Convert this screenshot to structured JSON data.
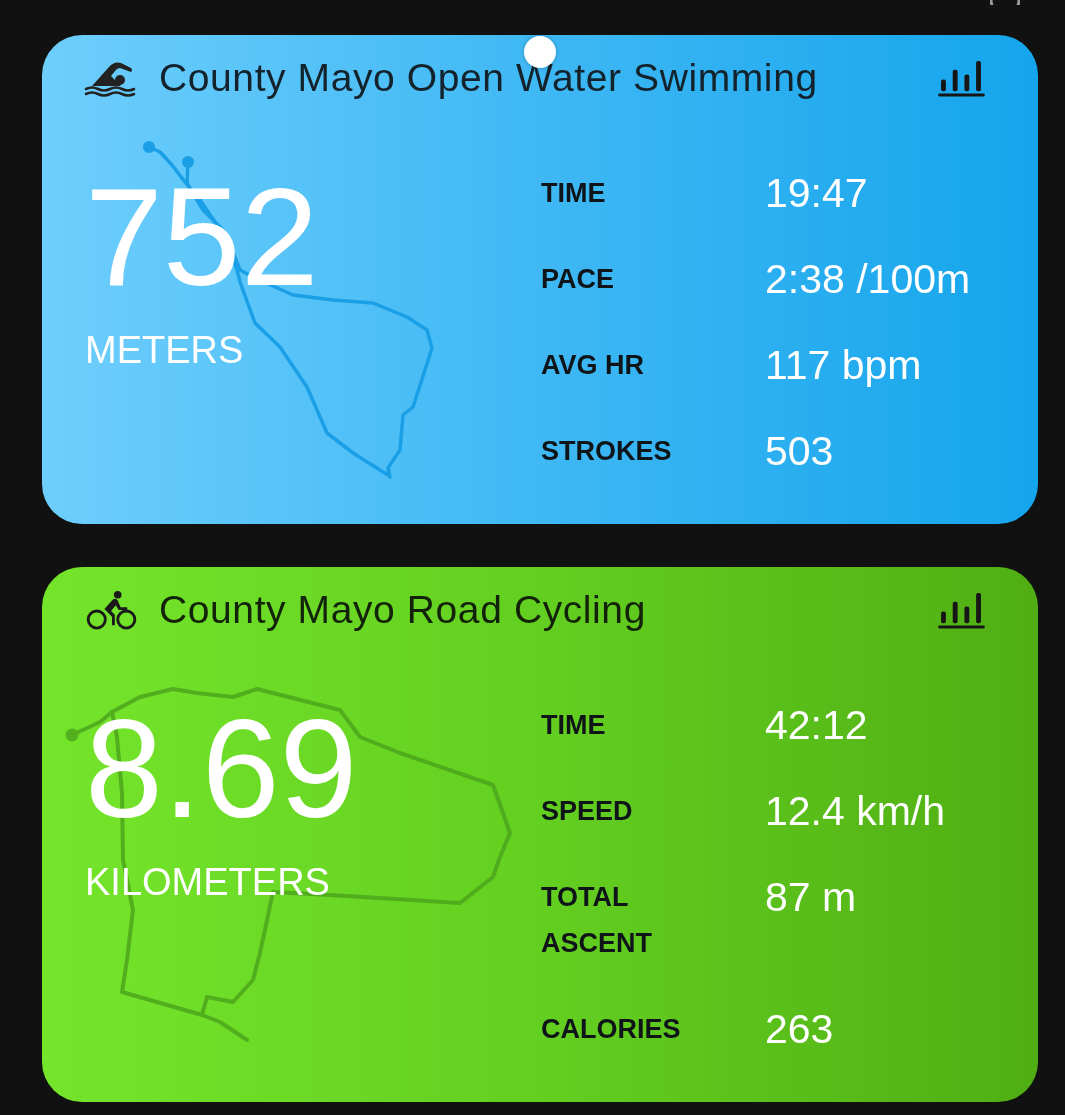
{
  "activities": [
    {
      "kind": "swim",
      "title": "County Mayo Open Water Swimming",
      "distance": "752",
      "unit": "METERS",
      "stats": [
        {
          "label": "TIME",
          "value": "19:47"
        },
        {
          "label": "PACE",
          "value": "2:38 /100m"
        },
        {
          "label": "AVG HR",
          "value": "117 bpm"
        },
        {
          "label": "STROKES",
          "value": "503"
        }
      ]
    },
    {
      "kind": "cycle",
      "title": "County Mayo Road Cycling",
      "distance": "8.69",
      "unit": "KILOMETERS",
      "stats": [
        {
          "label": "TIME",
          "value": "42:12"
        },
        {
          "label": "SPEED",
          "value": "12.4 km/h"
        },
        {
          "label": "TOTAL ASCENT",
          "value": "87 m"
        },
        {
          "label": "CALORIES",
          "value": "263"
        }
      ]
    }
  ]
}
